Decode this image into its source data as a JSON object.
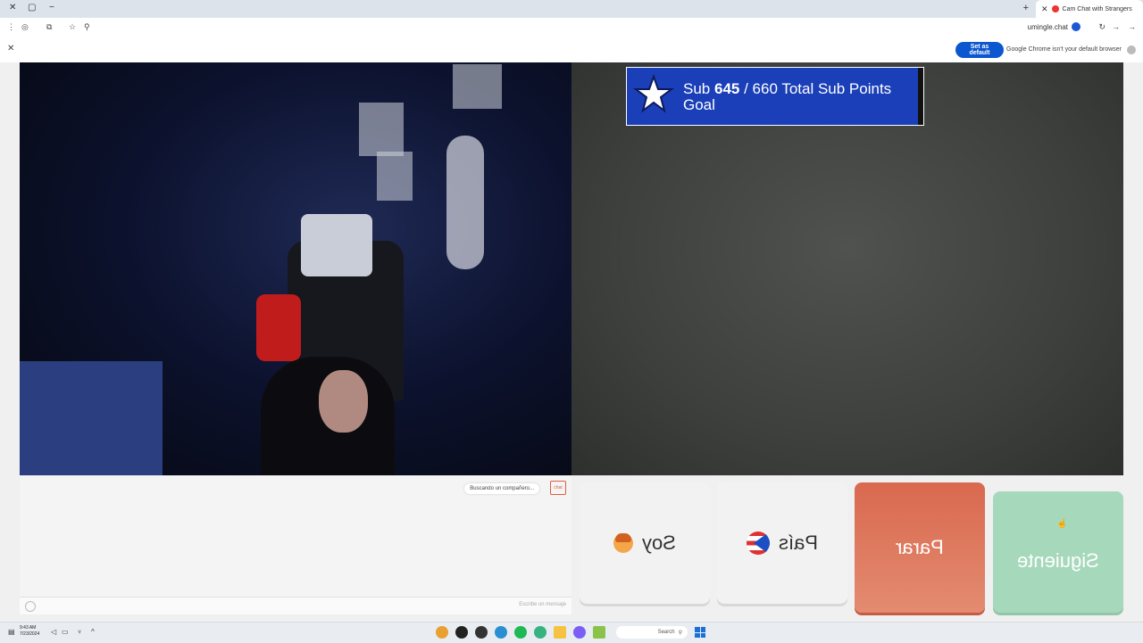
{
  "browser": {
    "tab_title": "Cam Chat with Strangers",
    "url": "umingle.chat",
    "infobar_message": "Google Chrome isn't your default browser",
    "set_default_label": "Set as default"
  },
  "overlay": {
    "sub_label": "Sub",
    "sub_current": "645",
    "sub_rest": "/ 660 Total Sub Points",
    "goal_label": "Goal"
  },
  "chat": {
    "status": "Buscando un compañero...",
    "logo_text": "chat",
    "input_placeholder": "Escribe un mensaje"
  },
  "controls": {
    "soy_label": "Soy",
    "pais_label": "País",
    "parar_label": "Parar",
    "siguiente_label": "Siguiente"
  },
  "taskbar": {
    "search_label": "Search",
    "time": "9:43 AM",
    "date": "7/23/2024"
  },
  "colors": {
    "parar": "#d9694f",
    "siguiente": "#a6d8bb",
    "overlay_bg": "#1a3fb8",
    "default_button": "#0b57d0"
  }
}
